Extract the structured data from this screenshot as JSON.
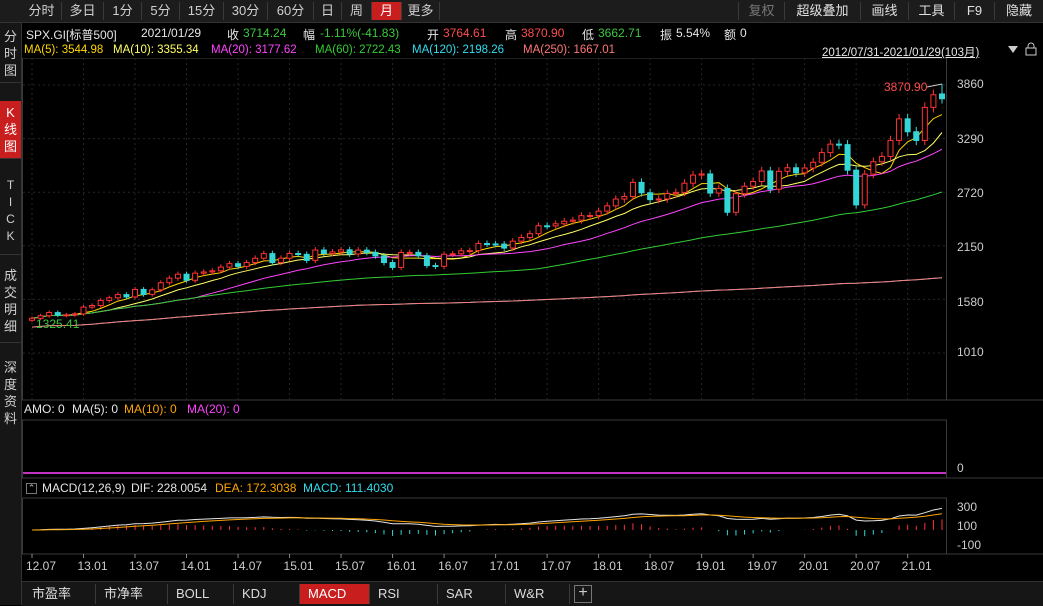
{
  "toolbar": {
    "periods": [
      "分时",
      "多日",
      "1分",
      "5分",
      "15分",
      "30分",
      "60分",
      "日",
      "周",
      "月",
      "更多"
    ],
    "active_period": "月",
    "tools": [
      "复权",
      "超级叠加",
      "画线",
      "工具",
      "F9",
      "隐藏"
    ]
  },
  "left_tabs": [
    "分时图",
    "K线图",
    "TICK",
    "成交明细",
    "深度资料"
  ],
  "active_left_tab": "K线图",
  "quote": {
    "symbol": "SPX.GI[标普500]",
    "date": "2021/01/29",
    "close_label": "收",
    "close": "3714.24",
    "change_label": "幅",
    "change": "-1.11%(-41.83)",
    "open_label": "开",
    "open": "3764.61",
    "high_label": "高",
    "high": "3870.90",
    "low_label": "低",
    "low": "3662.71",
    "amp_label": "振",
    "amp": "5.54%",
    "amount_label": "额",
    "amount": "0"
  },
  "ma_line": {
    "ma5": "MA(5): 3544.98",
    "ma10": "MA(10): 3355.34",
    "ma20": "MA(20): 3177.62",
    "ma60": "MA(60): 2722.43",
    "ma120": "MA(120): 2198.26",
    "ma250": "MA(250): 1667.01"
  },
  "range_label": "2012/07/31-2021/01/29(103月)",
  "price_axis": [
    "3860",
    "3290",
    "2720",
    "2150",
    "1580",
    "1010"
  ],
  "high_marker": "3870.90",
  "low_marker": "1325.41",
  "amo_line": {
    "amo": "AMO: 0",
    "ma5": "MA(5): 0",
    "ma10": "MA(10): 0",
    "ma20": "MA(20): 0"
  },
  "amo_axis": "0",
  "macd_line": {
    "title": "MACD(12,26,9)",
    "dif": "DIF: 228.0054",
    "dea": "DEA: 172.3038",
    "macd": "MACD: 111.4030"
  },
  "macd_axis": [
    "300",
    "100",
    "-100"
  ],
  "date_axis": [
    "12.07",
    "13.01",
    "13.07",
    "14.01",
    "14.07",
    "15.01",
    "15.07",
    "16.01",
    "16.07",
    "17.01",
    "17.07",
    "18.01",
    "18.07",
    "19.01",
    "19.07",
    "20.01",
    "20.07",
    "21.01"
  ],
  "bottom_tabs": [
    "市盈率",
    "市净率",
    "BOLL",
    "KDJ",
    "MACD",
    "RSI",
    "SAR",
    "W&R"
  ],
  "active_bottom_tab": "MACD",
  "colors": {
    "up": "#ff3333",
    "down": "#33d6d6",
    "active": "#c81e1e",
    "ma5": "#ffd700",
    "ma10": "#ffff66",
    "ma20": "#ff44ff",
    "ma60": "#33cc33",
    "ma120": "#33ddee",
    "ma250": "#ff7777"
  },
  "chart_data": {
    "type": "candlestick",
    "period": "monthly",
    "x_start": "2012-07",
    "x_end": "2021-01",
    "count": 103,
    "ylim": [
      1010,
      3860
    ],
    "monthly_close": [
      1379,
      1406,
      1440,
      1412,
      1416,
      1426,
      1498,
      1515,
      1569,
      1597,
      1631,
      1606,
      1686,
      1633,
      1682,
      1757,
      1806,
      1848,
      1783,
      1859,
      1872,
      1884,
      1924,
      1960,
      1931,
      1972,
      2018,
      2067,
      1972,
      2018,
      2068,
      2059,
      1995,
      2105,
      2068,
      2085,
      2107,
      2063,
      2104,
      2080,
      2043,
      1972,
      1920,
      2079,
      2080,
      2044,
      1940,
      1932,
      2060,
      2065,
      2097,
      2099,
      2174,
      2170,
      2168,
      2126,
      2199,
      2239,
      2279,
      2363,
      2362,
      2384,
      2411,
      2423,
      2470,
      2472,
      2519,
      2575,
      2647,
      2674,
      2824,
      2714,
      2641,
      2648,
      2705,
      2718,
      2816,
      2902,
      2914,
      2711,
      2760,
      2507,
      2704,
      2784,
      2834,
      2946,
      2752,
      2942,
      2980,
      2926,
      2977,
      3038,
      3141,
      3231,
      3226,
      2954,
      2585,
      2912,
      3044,
      3100,
      3271,
      3500,
      3363,
      3270,
      3622,
      3756,
      3714
    ],
    "ma": {
      "MA(5)": 3544.98,
      "MA(10)": 3355.34,
      "MA(20)": 3177.62,
      "MA(60)": 2722.43,
      "MA(120)": 2198.26,
      "MA(250)": 1667.01
    },
    "last_bar": {
      "open": 3764.61,
      "high": 3870.9,
      "low": 3662.71,
      "close": 3714.24
    },
    "macd": {
      "dif": 228.0054,
      "dea": 172.3038,
      "macd": 111.403
    }
  }
}
